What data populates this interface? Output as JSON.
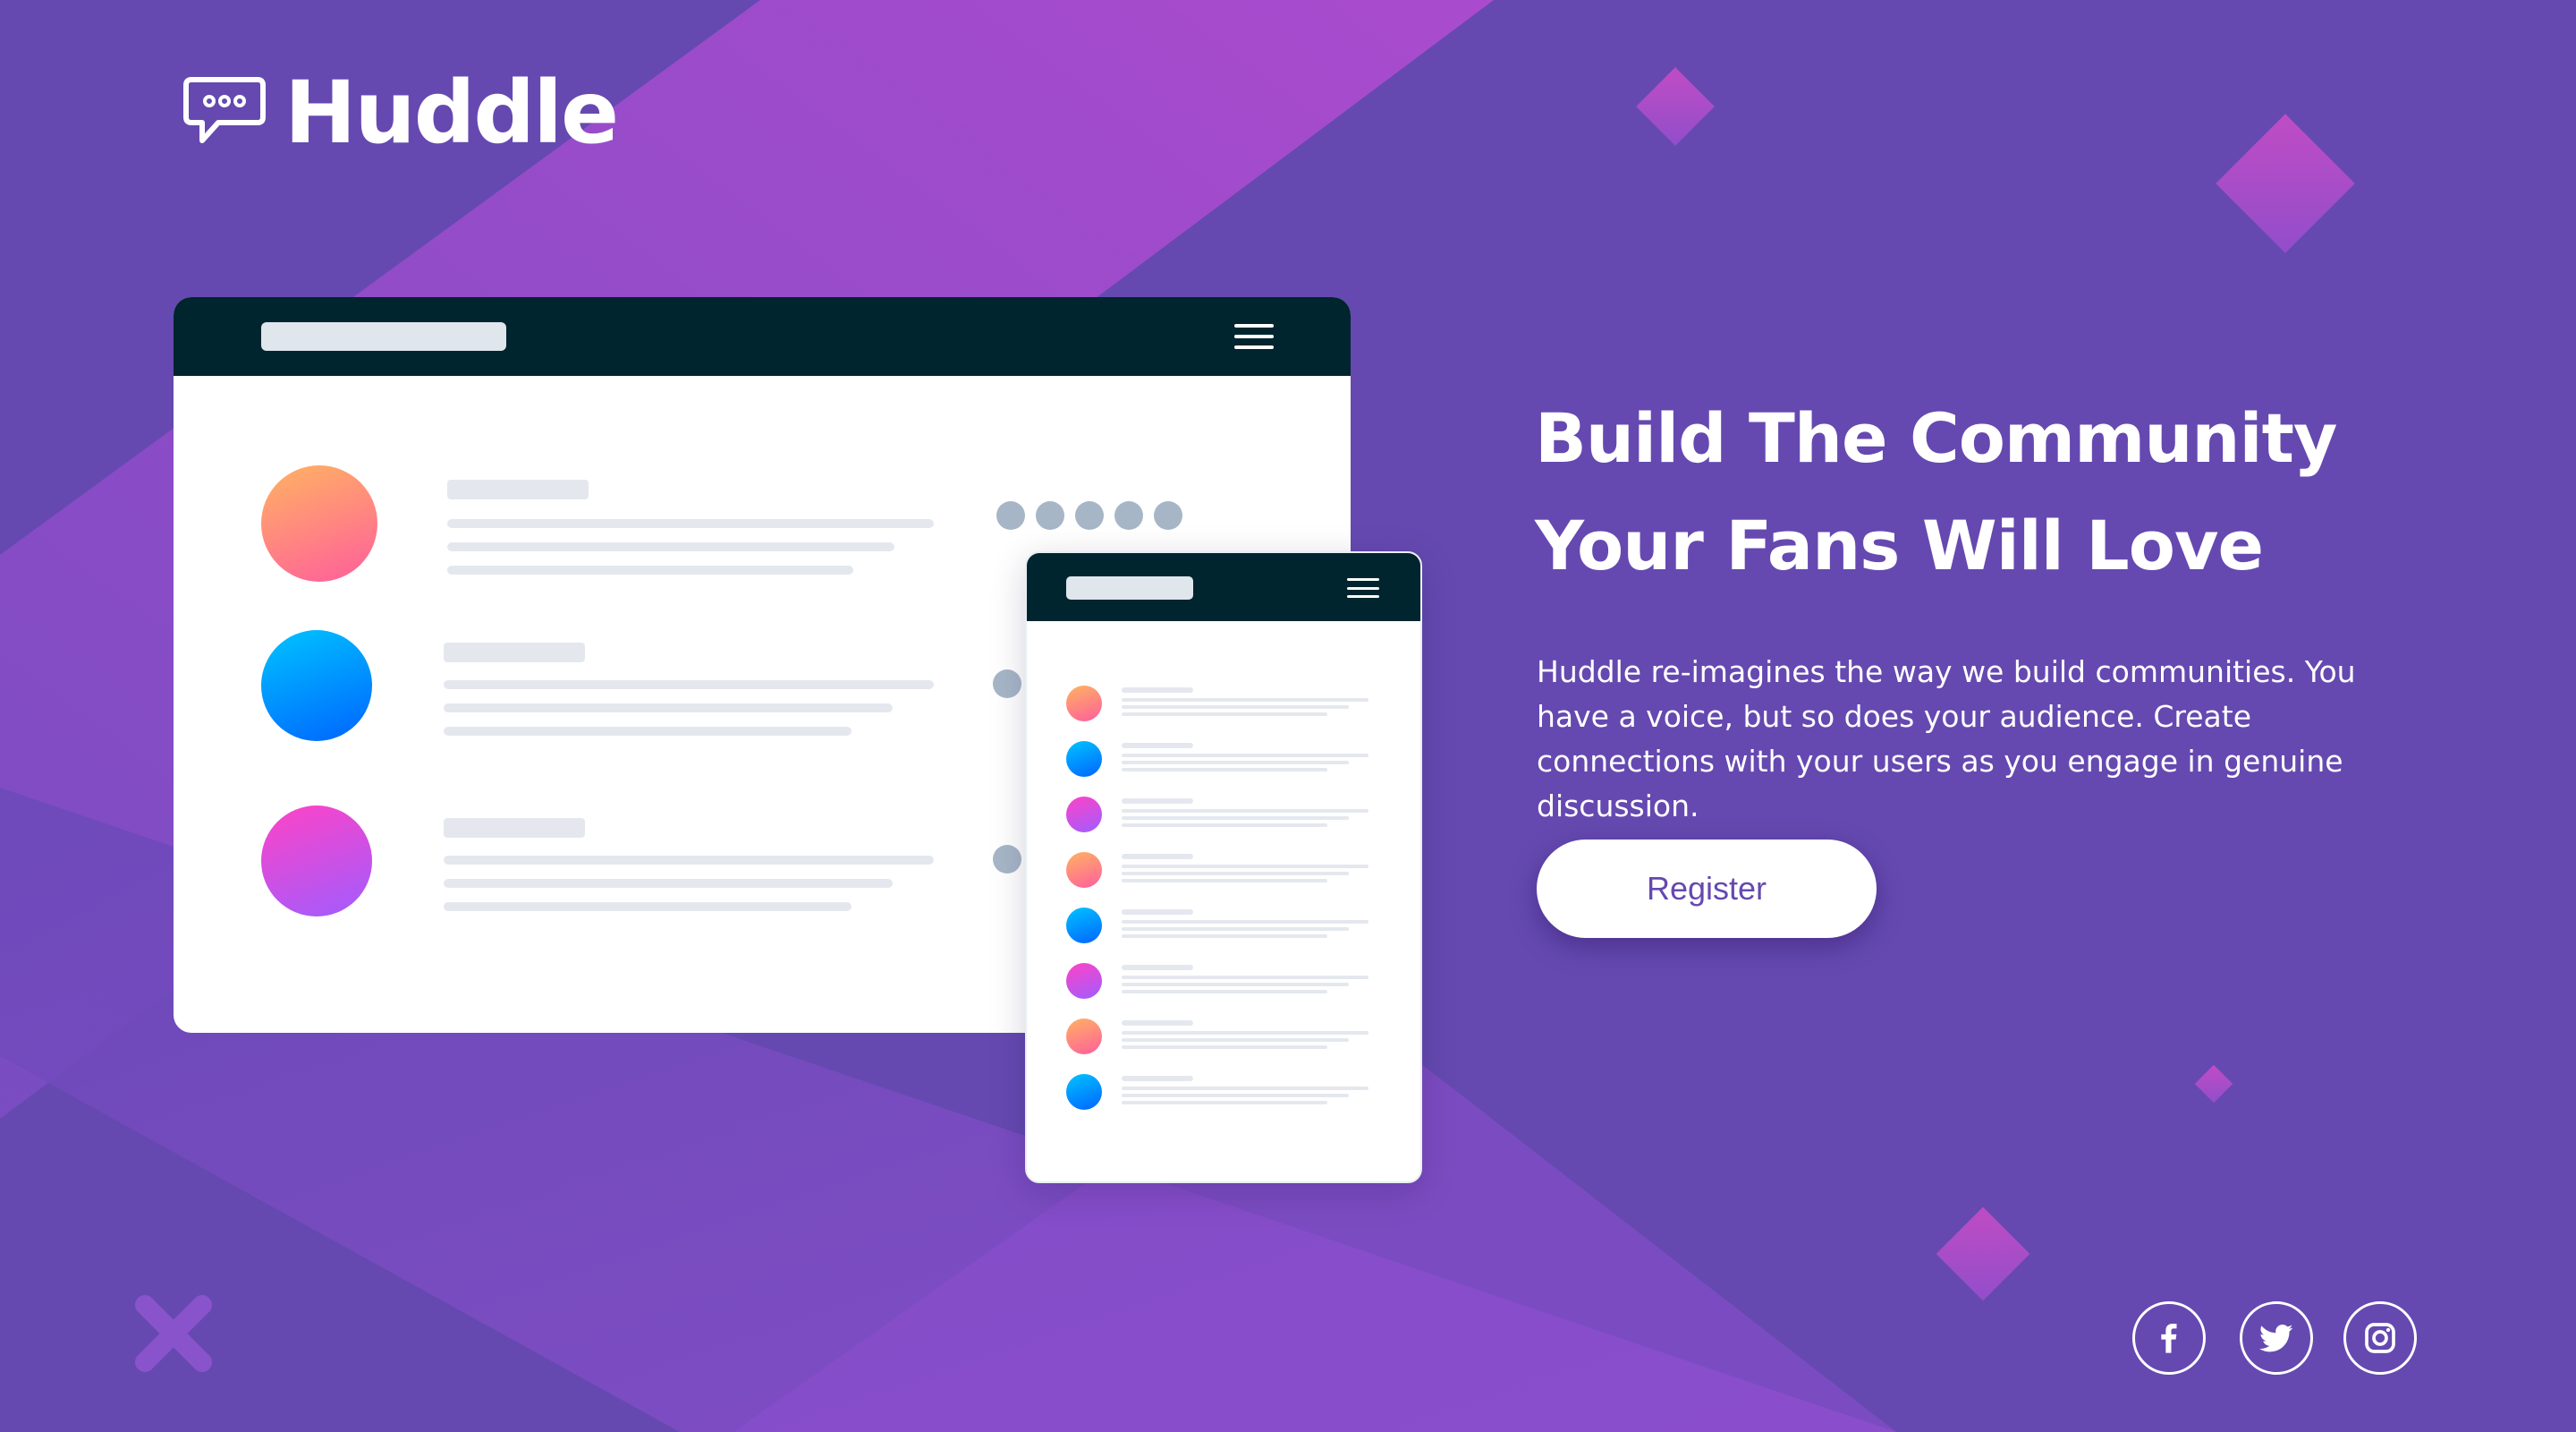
{
  "brand": {
    "name": "Huddle",
    "logo_icon": "speech-bubble-icon"
  },
  "hero": {
    "title_line1": "Build The Community",
    "title_line2": "Your Fans Will Love",
    "description": "Huddle re-imagines the way we build communities. You have a voice, but so does your audience. Create connections with your users as you engage in genuine discussion.",
    "register_label": "Register"
  },
  "social": [
    {
      "name": "facebook-icon"
    },
    {
      "name": "twitter-icon"
    },
    {
      "name": "instagram-icon"
    }
  ],
  "colors": {
    "background": "#6549b0",
    "accent_violet": "#c650d6",
    "mockup_header": "#00252e",
    "button_text": "#6549b0"
  }
}
